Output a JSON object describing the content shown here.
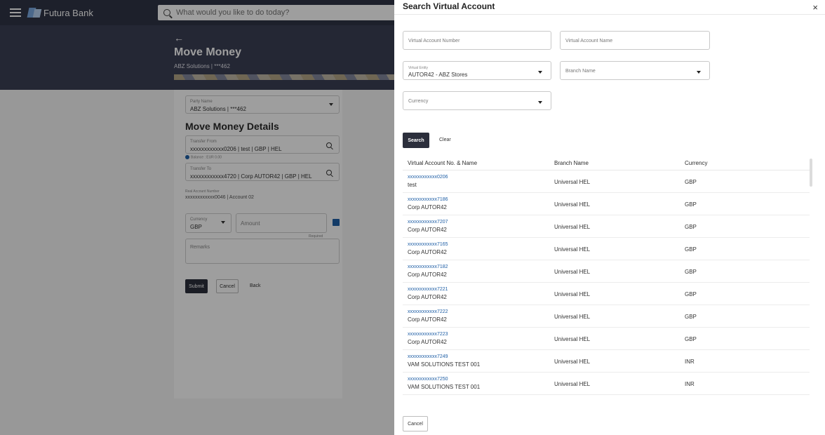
{
  "app": {
    "brand": "Futura Bank",
    "search_placeholder": "What would you like to do today?"
  },
  "page": {
    "title": "Move Money",
    "subtitle": "ABZ Solutions | ***462",
    "party": {
      "label": "Party Name",
      "value": "ABZ Solutions | ***462"
    },
    "section_title": "Move Money Details",
    "transfer_from": {
      "label": "Transfer From",
      "value": "xxxxxxxxxxxx0206 | test | GBP | HEL"
    },
    "balance": "Balance : EUR 0.00",
    "transfer_to": {
      "label": "Transfer To",
      "value": "xxxxxxxxxxxx4720 | Corp AUTOR42 | GBP | HEL"
    },
    "real_account": {
      "label": "Real Account Number",
      "value": "xxxxxxxxxxxx0046 | Account 02"
    },
    "currency": {
      "label": "Currency",
      "value": "GBP"
    },
    "amount_placeholder": "Amount",
    "required": "Required",
    "remarks_placeholder": "Remarks",
    "submit": "Submit",
    "cancel": "Cancel",
    "back": "Back"
  },
  "modal": {
    "title": "Search Virtual Account",
    "close": "×",
    "va_number_placeholder": "Virtual Account Number",
    "va_name_placeholder": "Virtual Account Name",
    "entity": {
      "label": "Virtual Entity",
      "value": "AUTOR42 - ABZ Stores"
    },
    "branch_placeholder": "Branch Name",
    "currency_placeholder": "Currency",
    "search": "Search",
    "clear": "Clear",
    "columns": [
      "Virtual Account No. & Name",
      "Branch Name",
      "Currency"
    ],
    "rows": [
      {
        "account": "xxxxxxxxxxxx0206",
        "name": "test",
        "branch": "Universal HEL",
        "currency": "GBP"
      },
      {
        "account": "xxxxxxxxxxxx7186",
        "name": "Corp AUTOR42",
        "branch": "Universal HEL",
        "currency": "GBP"
      },
      {
        "account": "xxxxxxxxxxxx7207",
        "name": "Corp AUTOR42",
        "branch": "Universal HEL",
        "currency": "GBP"
      },
      {
        "account": "xxxxxxxxxxxx7165",
        "name": "Corp AUTOR42",
        "branch": "Universal HEL",
        "currency": "GBP"
      },
      {
        "account": "xxxxxxxxxxxx7182",
        "name": "Corp AUTOR42",
        "branch": "Universal HEL",
        "currency": "GBP"
      },
      {
        "account": "xxxxxxxxxxxx7221",
        "name": "Corp AUTOR42",
        "branch": "Universal HEL",
        "currency": "GBP"
      },
      {
        "account": "xxxxxxxxxxxx7222",
        "name": "Corp AUTOR42",
        "branch": "Universal HEL",
        "currency": "GBP"
      },
      {
        "account": "xxxxxxxxxxxx7223",
        "name": "Corp AUTOR42",
        "branch": "Universal HEL",
        "currency": "GBP"
      },
      {
        "account": "xxxxxxxxxxxx7249",
        "name": "VAM SOLUTIONS TEST 001",
        "branch": "Universal HEL",
        "currency": "INR"
      },
      {
        "account": "xxxxxxxxxxxx7250",
        "name": "VAM SOLUTIONS TEST 001",
        "branch": "Universal HEL",
        "currency": "INR"
      }
    ],
    "cancel": "Cancel"
  }
}
